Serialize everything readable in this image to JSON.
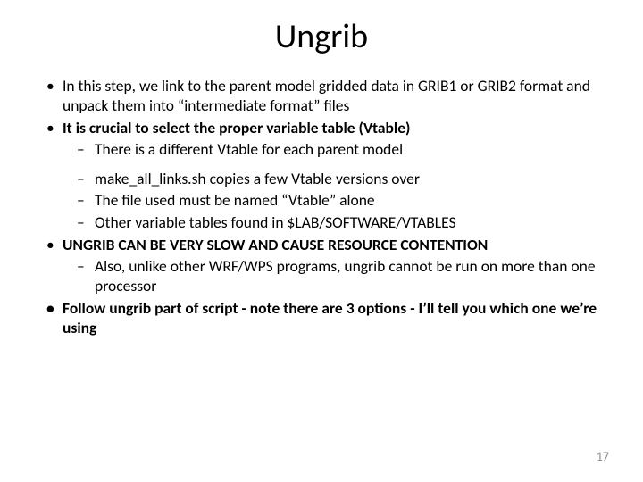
{
  "title": "Ungrib",
  "b1": "In this step, we link to the parent model gridded data in GRIB1 or GRIB2 format and unpack them into “intermediate format” files",
  "b2": "It is crucial to select the proper variable table (Vtable)",
  "b2s1": "There is a different Vtable for each parent model",
  "b2s2": "make_all_links.sh copies a few Vtable versions over",
  "b2s3": "The file used must be named “Vtable” alone",
  "b2s4": "Other variable tables found in $LAB/SOFTWARE/VTABLES",
  "b3": "UNGRIB CAN BE VERY SLOW AND CAUSE RESOURCE CONTENTION",
  "b3s1": "Also, unlike other WRF/WPS programs, ungrib cannot be run on more than one processor",
  "b4": "Follow ungrib part of script - note there are 3 options - I’ll tell you which one we’re using",
  "pagenum": "17"
}
